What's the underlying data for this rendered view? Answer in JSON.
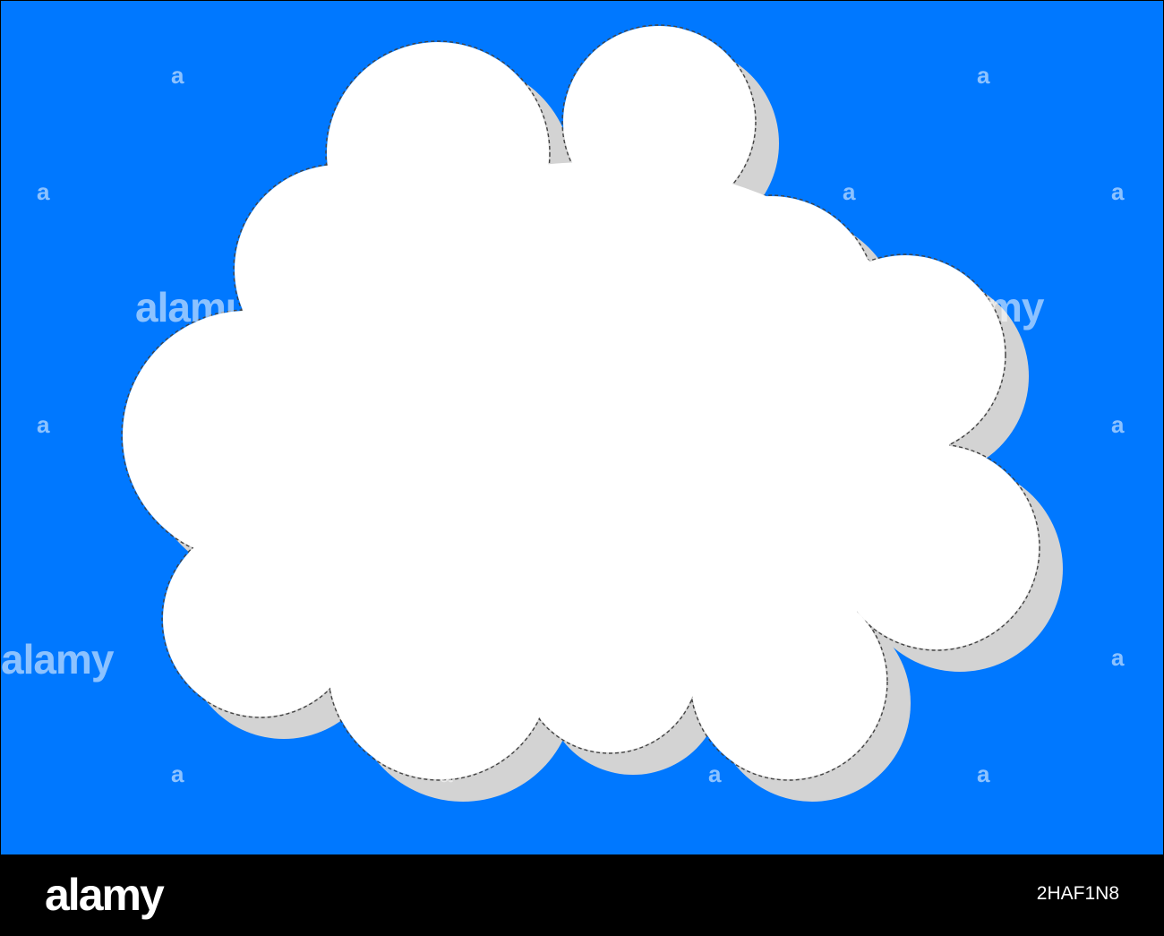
{
  "colors": {
    "sky": "#0078ff",
    "cloud": "#ffffff",
    "shadow": "#d3d3d3",
    "outline": "#444444",
    "footer_bg": "#000000",
    "footer_text": "#ffffff",
    "watermark": "#ffffff"
  },
  "watermark": {
    "small_text": "a",
    "large_text": "alamy",
    "partial_left": "alamu",
    "partial_right": "my"
  },
  "footer": {
    "logo_text": "alamy",
    "image_code": "2HAF1N8"
  }
}
